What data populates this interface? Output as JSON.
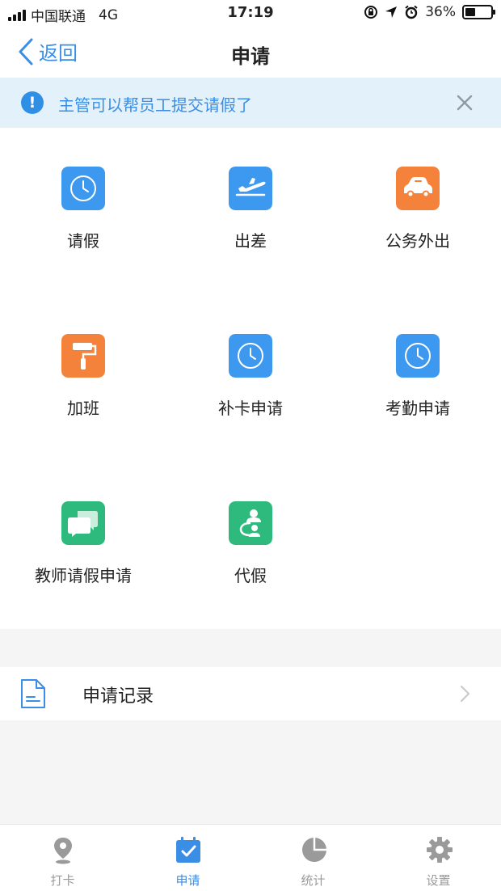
{
  "status_bar": {
    "carrier": "中国联通",
    "network": "4G",
    "time": "17:19",
    "battery": "36%"
  },
  "nav": {
    "back_label": "返回",
    "title": "申请"
  },
  "notice": {
    "text": "主管可以帮员工提交请假了",
    "info_glyph": "!"
  },
  "apps": [
    {
      "label": "请假",
      "icon": "clock-icon",
      "color": "#3d98f0"
    },
    {
      "label": "出差",
      "icon": "airplane-icon",
      "color": "#3d98f0"
    },
    {
      "label": "公务外出",
      "icon": "car-icon",
      "color": "#f5823a"
    },
    {
      "label": "加班",
      "icon": "paint-roller-icon",
      "color": "#f5823a"
    },
    {
      "label": "补卡申请",
      "icon": "clock-icon",
      "color": "#3d98f0"
    },
    {
      "label": "考勤申请",
      "icon": "clock-icon",
      "color": "#3d98f0"
    },
    {
      "label": "教师请假申请",
      "icon": "chat-bubbles-icon",
      "color": "#2dba7c"
    },
    {
      "label": "代假",
      "icon": "person-swap-icon",
      "color": "#2dba7c"
    }
  ],
  "record": {
    "label": "申请记录",
    "icon": "document-icon"
  },
  "tabs": [
    {
      "label": "打卡",
      "icon": "location-pin-icon",
      "active": false
    },
    {
      "label": "申请",
      "icon": "calendar-check-icon",
      "active": true
    },
    {
      "label": "统计",
      "icon": "pie-chart-icon",
      "active": false
    },
    {
      "label": "设置",
      "icon": "gear-icon",
      "active": false
    }
  ],
  "colors": {
    "accent": "#3a8ee6",
    "notice_bg": "#e3f1fb",
    "tab_inactive": "#9a9a9a"
  }
}
